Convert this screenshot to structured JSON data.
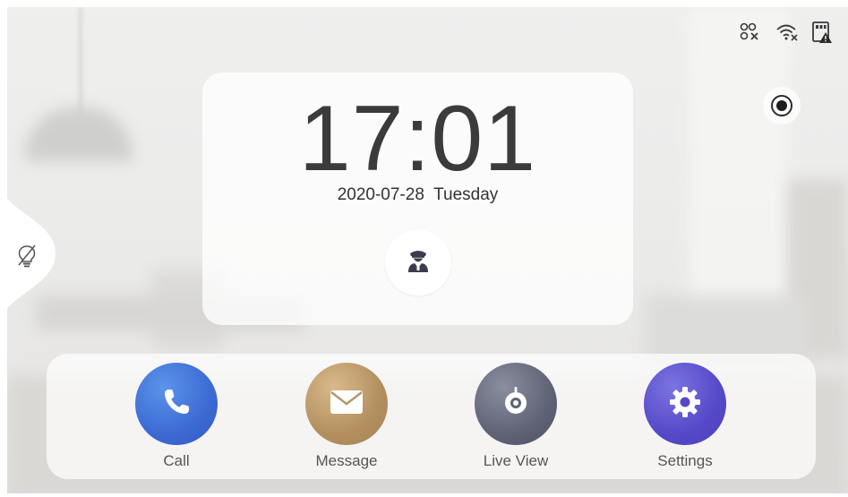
{
  "status_bar": {
    "icons": [
      "sip-disconnected-icon",
      "wifi-disconnected-icon",
      "sd-card-warning-icon"
    ]
  },
  "record_button": {
    "icon": "record-icon"
  },
  "side_tab": {
    "icon": "light-off-icon"
  },
  "clock": {
    "time": "17:01",
    "date": "2020-07-28",
    "weekday": "Tuesday",
    "guard_icon": "security-guard-icon"
  },
  "dock": {
    "items": [
      {
        "label": "Call",
        "icon": "phone-icon",
        "color": "#4578dc"
      },
      {
        "label": "Message",
        "icon": "envelope-icon",
        "color": "#b8956a"
      },
      {
        "label": "Live View",
        "icon": "camera-icon",
        "color": "#666a7c"
      },
      {
        "label": "Settings",
        "icon": "gear-icon",
        "color": "#5a4fcf"
      }
    ]
  }
}
